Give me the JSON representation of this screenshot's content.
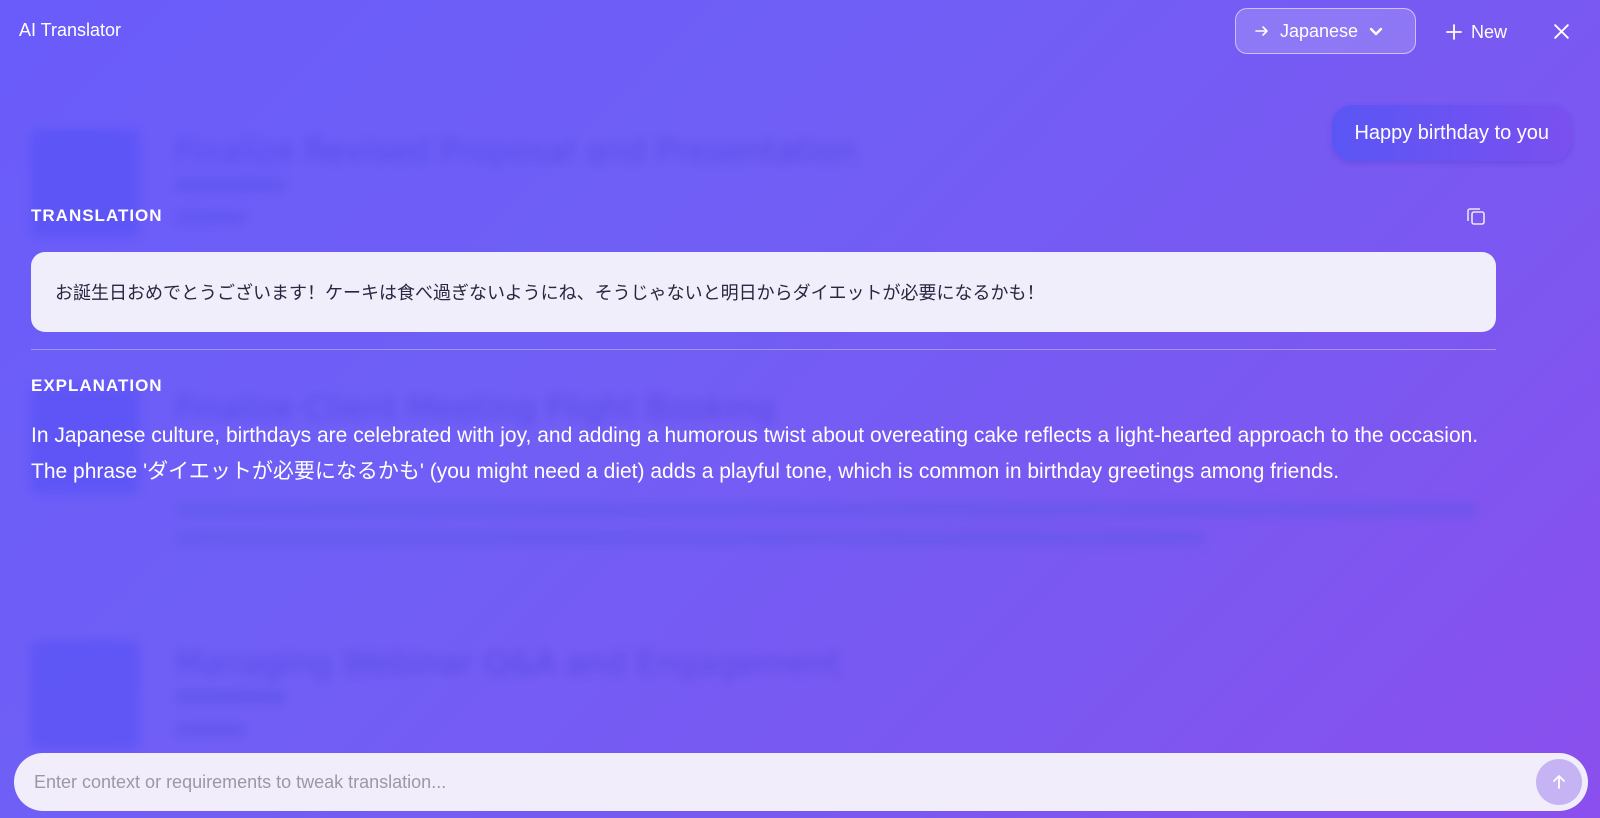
{
  "header": {
    "app_title": "AI Translator",
    "language": "Japanese",
    "new_label": "New"
  },
  "background": {
    "titles": [
      "Finalize Revised Proposal and Presentation",
      "Finalize Client Meeting Flight Booking",
      "Managing Webinar Q&A and Engagement"
    ]
  },
  "chat": {
    "user_message": "Happy birthday to you"
  },
  "translation": {
    "label": "TRANSLATION",
    "text": "お誕生日おめでとうございます！ケーキは食べ過ぎないようにね、そうじゃないと明日からダイエットが必要になるかも！"
  },
  "explanation": {
    "label": "EXPLANATION",
    "text": "In Japanese culture, birthdays are celebrated with joy, and adding a humorous twist about overeating cake reflects a light-hearted approach to the occasion. The phrase 'ダイエットが必要になるかも' (you might need a diet) adds a playful tone, which is common in birthday greetings among friends."
  },
  "input": {
    "placeholder": "Enter context or requirements to tweak translation..."
  },
  "icons": {
    "arrow_right": "arrow-right-icon",
    "chevron_down": "chevron-down-icon",
    "plus": "plus-icon",
    "close": "close-icon",
    "copy": "copy-icon",
    "send": "arrow-up-icon"
  },
  "colors": {
    "background_start": "#6a5cfa",
    "background_end": "#8b4fee",
    "bubble_start": "#5a56f5",
    "bubble_end": "#7b4ff0",
    "translation_box": "#f1eefc",
    "send_button": "#c5b3f3"
  }
}
